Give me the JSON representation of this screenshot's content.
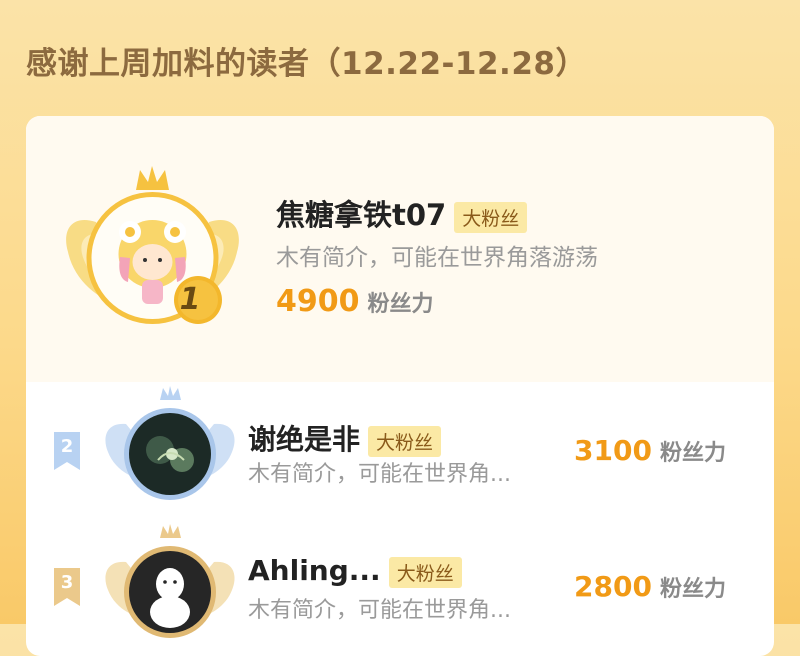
{
  "heading": "感谢上周加料的读者（12.22-12.28）",
  "colors": {
    "accent": "#f19a16",
    "badge_bg": "#fbe9a5",
    "badge_text": "#8a5a1a",
    "gold": "#f6c240",
    "silver": "#b8d2f2",
    "bronze": "#ebc98b"
  },
  "readers": [
    {
      "rank": "1",
      "name": "焦糖拿铁t07",
      "badge": "大粉丝",
      "bio": "木有简介，可能在世界角落游荡",
      "score": "4900",
      "score_unit": "粉丝力"
    },
    {
      "rank": "2",
      "name": "谢绝是非",
      "badge": "大粉丝",
      "bio": "木有简介，可能在世界角...",
      "score": "3100",
      "score_unit": "粉丝力"
    },
    {
      "rank": "3",
      "name": "Ahling...",
      "badge": "大粉丝",
      "bio": "木有简介，可能在世界角...",
      "score": "2800",
      "score_unit": "粉丝力"
    }
  ]
}
